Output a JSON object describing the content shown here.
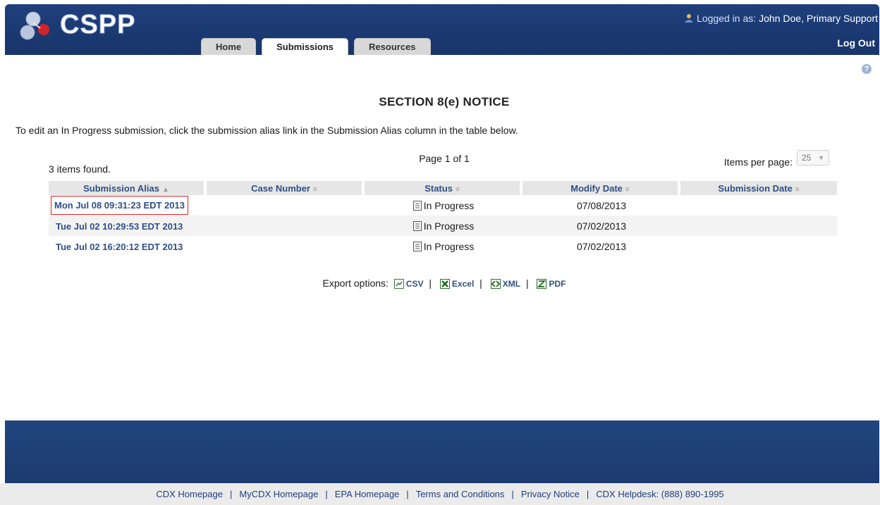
{
  "header": {
    "logo_text": "CSPP",
    "logged_in_prefix": "Logged in as:",
    "user_name": "John Doe, Primary Support",
    "logout_label": "Log Out",
    "tabs": [
      {
        "label": "Home",
        "active": false
      },
      {
        "label": "Submissions",
        "active": true
      },
      {
        "label": "Resources",
        "active": false
      }
    ]
  },
  "main": {
    "section_title": "SECTION 8(e) NOTICE",
    "instructions": "To edit an In Progress submission, click the submission alias link in the Submission Alias column in the table below.",
    "page_indicator": "Page 1 of 1",
    "items_found": "3 items found.",
    "items_per_page_label": "Items per page:",
    "items_per_page_value": "25"
  },
  "table": {
    "columns": [
      "Submission Alias",
      "Case Number",
      "Status",
      "Modify Date",
      "Submission Date"
    ],
    "rows": [
      {
        "alias": "Mon Jul 08 09:31:23 EDT 2013",
        "case_number": "",
        "status": "In Progress",
        "modify_date": "07/08/2013",
        "submission_date": "",
        "highlighted": true
      },
      {
        "alias": "Tue Jul 02 10:29:53 EDT 2013",
        "case_number": "",
        "status": "In Progress",
        "modify_date": "07/02/2013",
        "submission_date": "",
        "highlighted": false
      },
      {
        "alias": "Tue Jul 02 16:20:12 EDT 2013",
        "case_number": "",
        "status": "In Progress",
        "modify_date": "07/02/2013",
        "submission_date": "",
        "highlighted": false
      }
    ]
  },
  "export": {
    "label": "Export options:",
    "options": [
      "CSV",
      "Excel",
      "XML",
      "PDF"
    ]
  },
  "footer": {
    "links": [
      "CDX Homepage",
      "MyCDX Homepage",
      "EPA Homepage",
      "Terms and Conditions",
      "Privacy Notice",
      "CDX Helpdesk: (888) 890-1995"
    ]
  },
  "colors": {
    "header_bg": "#1f3f7d",
    "link": "#2e4f86",
    "highlight_border": "#e02020"
  }
}
